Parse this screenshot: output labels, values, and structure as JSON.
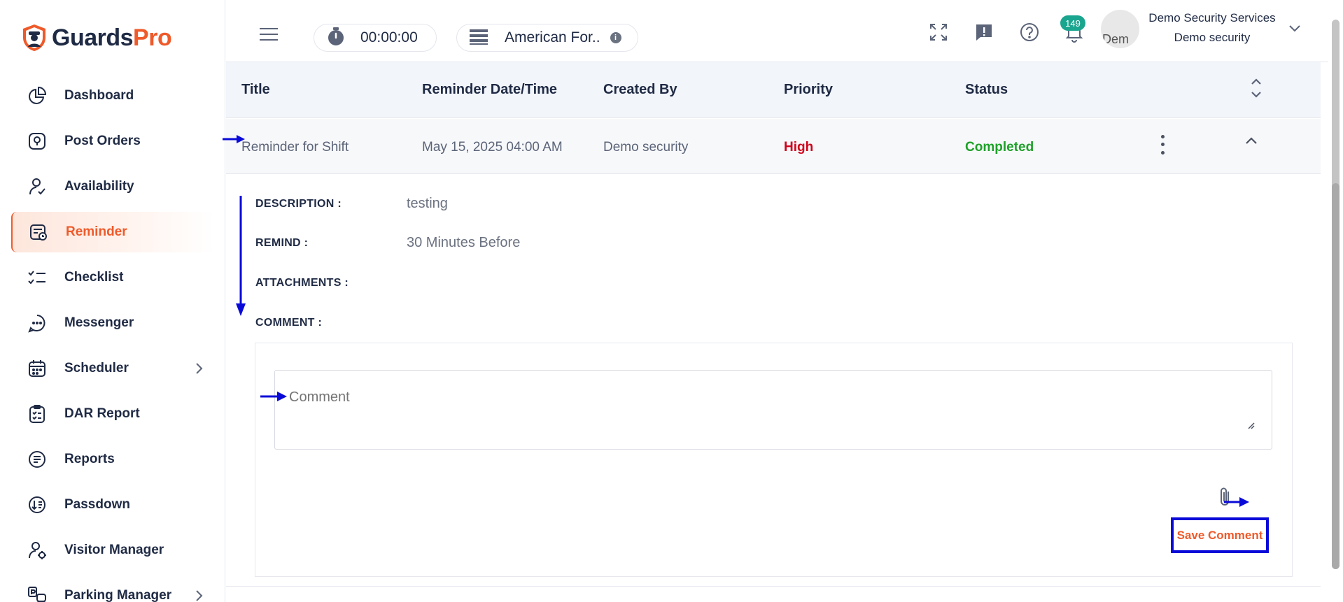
{
  "brand": {
    "name_part1": "Guards",
    "name_part2": "Pro",
    "accent": "#ef5a2a",
    "navy": "#1f2a44"
  },
  "sidebar": {
    "items": [
      {
        "label": "Dashboard",
        "icon": "pie-chart-icon"
      },
      {
        "label": "Post Orders",
        "icon": "location-badge-icon"
      },
      {
        "label": "Availability",
        "icon": "user-check-icon"
      },
      {
        "label": "Reminder",
        "icon": "calendar-reminder-icon",
        "active": true
      },
      {
        "label": "Checklist",
        "icon": "checklist-icon"
      },
      {
        "label": "Messenger",
        "icon": "chat-bubble-icon"
      },
      {
        "label": "Scheduler",
        "icon": "calendar-icon",
        "has_submenu": true
      },
      {
        "label": "DAR Report",
        "icon": "clipboard-icon"
      },
      {
        "label": "Reports",
        "icon": "document-icon"
      },
      {
        "label": "Passdown",
        "icon": "passdown-icon"
      },
      {
        "label": "Visitor Manager",
        "icon": "visitor-icon"
      },
      {
        "label": "Parking Manager",
        "icon": "parking-icon",
        "has_submenu": true
      }
    ]
  },
  "header": {
    "timer": "00:00:00",
    "site": "American For..",
    "notification_count": "149",
    "company": "Demo Security Services",
    "user": "Demo security",
    "avatar_alt": "Dem"
  },
  "table": {
    "columns": [
      "Title",
      "Reminder Date/Time",
      "Created By",
      "Priority",
      "Status"
    ],
    "row": {
      "title": "Reminder for Shift",
      "datetime": "May 15, 2025 04:00 AM",
      "created_by": "Demo security",
      "priority": "High",
      "status": "Completed"
    }
  },
  "details": {
    "description_label": "DESCRIPTION :",
    "description_value": "testing",
    "remind_label": "REMIND :",
    "remind_value": "30 Minutes Before",
    "attachments_label": "ATTACHMENTS :",
    "comment_label": "COMMENT :"
  },
  "comment": {
    "placeholder": "Comment",
    "save_label": "Save Comment"
  }
}
